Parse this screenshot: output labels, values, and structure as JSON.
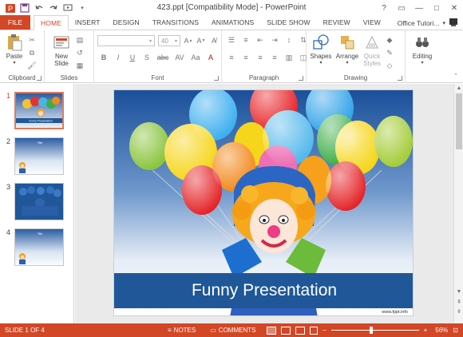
{
  "window": {
    "title": "423.ppt [Compatibility Mode] - PowerPoint",
    "controls": [
      "?",
      "▭",
      "—",
      "□",
      "✕"
    ]
  },
  "tabs": [
    "FILE",
    "HOME",
    "INSERT",
    "DESIGN",
    "TRANSITIONS",
    "ANIMATIONS",
    "SLIDE SHOW",
    "REVIEW",
    "VIEW"
  ],
  "active_tab": "HOME",
  "account": "Office Tutori...",
  "ribbon": {
    "clipboard": {
      "paste": "Paste",
      "label": "Clipboard"
    },
    "slides": {
      "new_slide": "New Slide",
      "label": "Slides"
    },
    "font": {
      "size": "40",
      "label": "Font",
      "buttons": [
        "B",
        "I",
        "U",
        "S",
        "abc",
        "AV",
        "Aa"
      ]
    },
    "paragraph": {
      "label": "Paragraph"
    },
    "drawing": {
      "shapes": "Shapes",
      "arrange": "Arrange",
      "quick_styles": "Quick Styles",
      "label": "Drawing"
    },
    "editing": {
      "label": "Editing"
    }
  },
  "slides": [
    {
      "num": "1",
      "title": "Funny Presentation",
      "active": true
    },
    {
      "num": "2",
      "title": "Title",
      "active": false
    },
    {
      "num": "3",
      "title": "",
      "active": false
    },
    {
      "num": "4",
      "title": "Title",
      "active": false
    }
  ],
  "slide": {
    "title": "Funny Presentation",
    "footer": "www.fppt.info"
  },
  "status": {
    "slide_info": "SLIDE 1 OF 4",
    "notes": "NOTES",
    "comments": "COMMENTS",
    "zoom": "56%",
    "zoom_minus": "−",
    "zoom_plus": "+"
  },
  "colors": {
    "accent": "#d24726",
    "banner": "#1f5799"
  }
}
